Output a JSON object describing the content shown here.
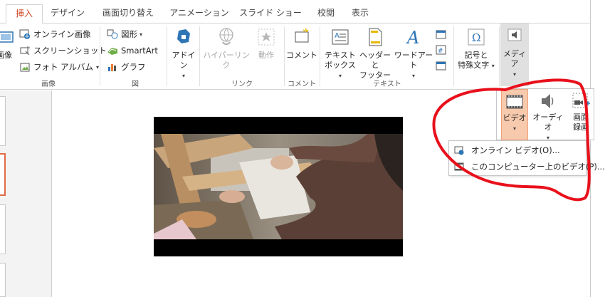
{
  "tabs": [
    {
      "label": "挿入",
      "active": true
    },
    {
      "label": "デザイン",
      "active": false
    },
    {
      "label": "画面切り替え",
      "active": false
    },
    {
      "label": "アニメーション",
      "active": false
    },
    {
      "label": "スライド ショー",
      "active": false
    },
    {
      "label": "校閲",
      "active": false
    },
    {
      "label": "表示",
      "active": false
    }
  ],
  "images_group": {
    "partial_label": "画像",
    "online_images": "オンライン画像",
    "screenshot": "スクリーンショット",
    "photo_album": "フォト アルバム",
    "group_label": "画像"
  },
  "illustrations_group": {
    "shapes": "図形",
    "smartart": "SmartArt",
    "chart": "グラフ",
    "group_label": "図"
  },
  "addins": {
    "label": "アドイン"
  },
  "links_group": {
    "hyperlink": "ハイパーリンク",
    "action": "動作",
    "group_label": "リンク"
  },
  "comments_group": {
    "comment": "コメント",
    "group_label": "コメント"
  },
  "text_group": {
    "textbox_l1": "テキスト",
    "textbox_l2": "ボックス",
    "header_l1": "ヘッダーと",
    "header_l2": "フッター",
    "wordart": "ワードアート",
    "group_label": "テキスト"
  },
  "symbols": {
    "l1": "記号と",
    "l2": "特殊文字"
  },
  "media": {
    "label": "メディア",
    "video": "ビデオ",
    "audio": "オーディオ",
    "screen_rec_l1": "画面",
    "screen_rec_l2": "録画"
  },
  "video_menu": [
    {
      "label": "オンライン ビデオ(O)..."
    },
    {
      "label": "このコンピューター上のビデオ(P)..."
    }
  ],
  "colors": {
    "accent": "#d24726",
    "annotation": "#e8101b",
    "active_media": "#f7c9ad"
  }
}
